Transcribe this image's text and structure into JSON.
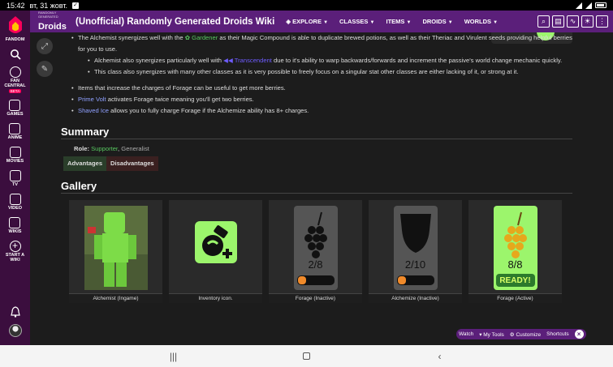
{
  "status_bar": {
    "time": "15:42",
    "date": "вт, 31 жовт."
  },
  "rail": {
    "fandom": "FANDOM",
    "fan_central": "FAN CENTRAL",
    "beta": "BETA",
    "games": "GAMES",
    "anime": "ANIME",
    "movies": "MOVIES",
    "tv": "TV",
    "video": "VIDEO",
    "wikis": "WIKIS",
    "start_wiki": "START A WIKI"
  },
  "nav": {
    "logo_small": "RANDOMLY GENERATED",
    "logo_big": "Droids",
    "title": "(Unofficial) Randomly Generated Droids Wiki",
    "links": [
      "EXPLORE",
      "CLASSES",
      "ITEMS",
      "DROIDS",
      "WORLDS"
    ]
  },
  "article": {
    "p1_a": "The Alchemist synergizes well with the ",
    "p1_gardener": "Gardener",
    "p1_b": " as their Magic Compound is able to duplicate brewed potions, as well as their Theriac and Virulent seeds providing helpful berries for you to use.",
    "p2_a": "Alchemist also synergizes particularly well with ",
    "p2_transcendent": "Transcendent",
    "p2_b": " due to it's ability to warp backwards/forwards and increment the passive's world change mechanic quickly.",
    "p3": "This class also synergizes with many other classes as it is very possible to freely focus on a singular stat other classes are either lacking of it, or strong at it.",
    "p4": "Items that increase the charges of Forage can be useful to get more berries.",
    "p5_link": "Prime Volt",
    "p5_b": " activates Forage twice meaning you'll get two berries.",
    "p6_link": "Shaved Ice",
    "p6_b": " allows you to fully charge Forage if the Alchemize ability has 8+ charges.",
    "summary_heading": "Summary",
    "role_label": "Role:",
    "role_primary": "Supporter",
    "role_sep": ", ",
    "role_secondary": "Generalist",
    "tab_adv": "Advantages",
    "tab_dis": "Disadvantages",
    "gallery_heading": "Gallery",
    "gallery": [
      {
        "caption": "Alchemist (Ingame)"
      },
      {
        "caption": "Inventory icon."
      },
      {
        "caption": "Forage (Inactive)",
        "counter": "2/8"
      },
      {
        "caption": "Alchemize (Inactive)",
        "counter": "2/10"
      },
      {
        "caption": "Forage (Active)",
        "counter": "8/8",
        "ready": "READY!"
      }
    ]
  },
  "toolbar": {
    "watch": "Watch",
    "my_tools": "My Tools",
    "customize": "Customize",
    "shortcuts": "Shortcuts"
  },
  "colors": {
    "nav": "#5b1f7a",
    "rail": "#3b0e3e",
    "green_link": "#57c65f",
    "blue_link": "#8fa0ff"
  }
}
